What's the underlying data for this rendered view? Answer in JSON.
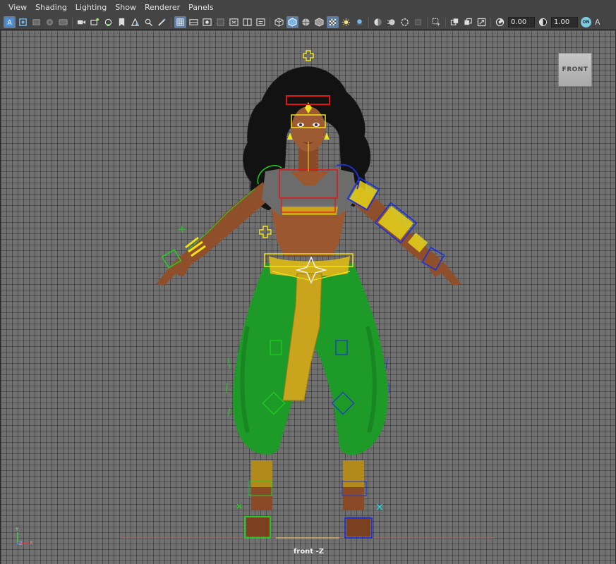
{
  "menu": [
    "View",
    "Shading",
    "Lighting",
    "Show",
    "Renderer",
    "Panels"
  ],
  "toolbar": {
    "exposure_value": "0.00",
    "gamma_value": "1.00",
    "toggle_label": "ON",
    "trailing_letter": "A"
  },
  "viewport": {
    "viewcube_label": "FRONT",
    "camera_label": "front -Z",
    "axes": {
      "y": "Y",
      "x": "X",
      "z": "Z"
    }
  },
  "colors": {
    "menubar": "#444444",
    "viewport_bg": "#6f6f6f",
    "highlight_blue": "#5d7fa3",
    "rig_yellow": "#f2e21a",
    "rig_red": "#e51414",
    "rig_green": "#1fd11f",
    "rig_blue": "#1e35d6",
    "pants_green": "#1e9a28",
    "skin": "#9a5730"
  },
  "icons": [
    "select-camera-icon",
    "camera-attributes-icon",
    "bookmark-icon",
    "image-plane-icon",
    "two-d-pan-icon",
    "grease-pencil-icon",
    "grid-icon",
    "film-gate-icon",
    "resolution-gate-icon",
    "gate-mask-icon",
    "field-chart-icon",
    "safe-action-icon",
    "wireframe-icon",
    "smooth-shade-icon",
    "wireframe-on-shaded-icon",
    "default-material-icon",
    "textured-icon",
    "use-lights-icon",
    "shadows-icon",
    "ambient-occlusion-icon",
    "motion-blur-icon",
    "anti-aliasing-icon",
    "isolate-select-icon",
    "xray-icon",
    "xray-joints-icon",
    "xray-components-icon",
    "exposure-icon",
    "gamma-icon",
    "color-management-icon"
  ]
}
